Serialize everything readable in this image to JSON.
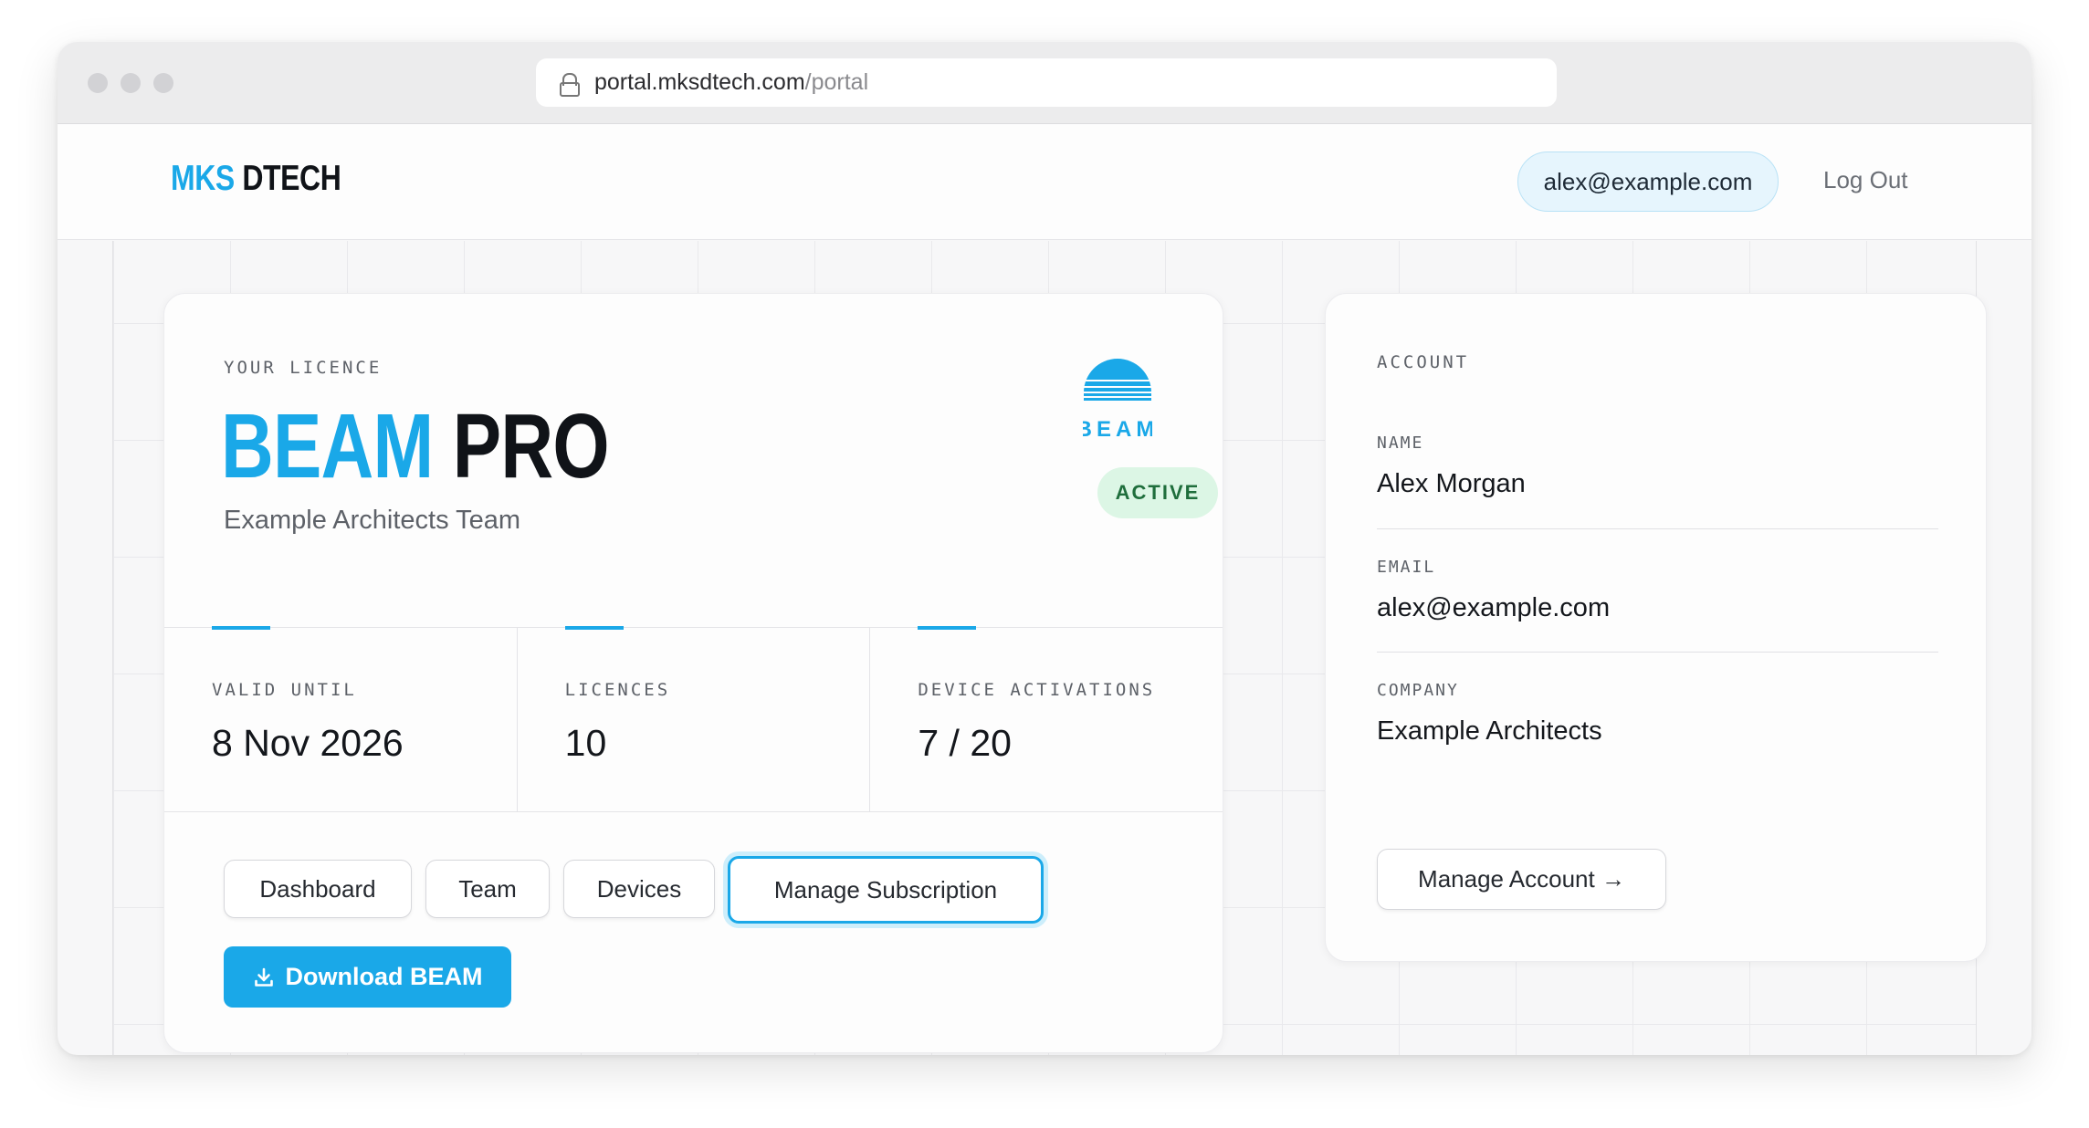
{
  "browser": {
    "url_host": "portal.mksdtech.com",
    "url_path": "/portal"
  },
  "header": {
    "logo_part1": "MKS",
    "logo_part2": "DTECH",
    "user_email": "alex@example.com",
    "logout_label": "Log Out"
  },
  "licence": {
    "eyebrow": "YOUR LICENCE",
    "product_part1": "BEAM",
    "product_part2": "PRO",
    "team_name": "Example Architects Team",
    "brand_mark_text": "BEAM",
    "status": "ACTIVE",
    "stats": [
      {
        "label": "VALID UNTIL",
        "value": "8 Nov 2026"
      },
      {
        "label": "LICENCES",
        "value": "10"
      },
      {
        "label": "DEVICE ACTIVATIONS",
        "value": "7 / 20"
      }
    ],
    "buttons": {
      "dashboard": "Dashboard",
      "team": "Team",
      "devices": "Devices",
      "manage_subscription": "Manage Subscription",
      "download": "Download BEAM"
    }
  },
  "account": {
    "eyebrow": "ACCOUNT",
    "name_label": "NAME",
    "name_value": "Alex Morgan",
    "email_label": "EMAIL",
    "email_value": "alex@example.com",
    "company_label": "COMPANY",
    "company_value": "Example Architects",
    "manage_label": "Manage Account →"
  },
  "colors": {
    "accent": "#1aa8e8",
    "status_bg": "#dcf6e5",
    "status_text": "#1f6e3c"
  }
}
